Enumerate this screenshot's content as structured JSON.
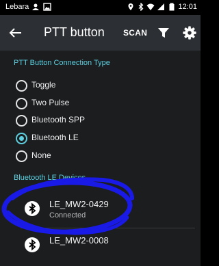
{
  "status_bar": {
    "carrier": "Lebara",
    "time": "12:01"
  },
  "toolbar": {
    "title": "PTT button",
    "scan_label": "SCAN"
  },
  "connection_type": {
    "header": "PTT Button Connection Type",
    "options": [
      {
        "label": "Toggle",
        "checked": false
      },
      {
        "label": "Two Pulse",
        "checked": false
      },
      {
        "label": "Bluetooth SPP",
        "checked": false
      },
      {
        "label": "Bluetooth LE",
        "checked": true
      },
      {
        "label": "None",
        "checked": false
      }
    ]
  },
  "ble_devices": {
    "header": "Bluetooth LE Devices",
    "items": [
      {
        "name": "LE_MW2-0429",
        "status": "Connected"
      },
      {
        "name": "LE_MW2-0008",
        "status": ""
      }
    ]
  },
  "colors": {
    "accent": "#5ed0e0",
    "highlight": "#1a1ae6",
    "background": "#1b1d1f",
    "toolbar": "#2c2f33"
  }
}
